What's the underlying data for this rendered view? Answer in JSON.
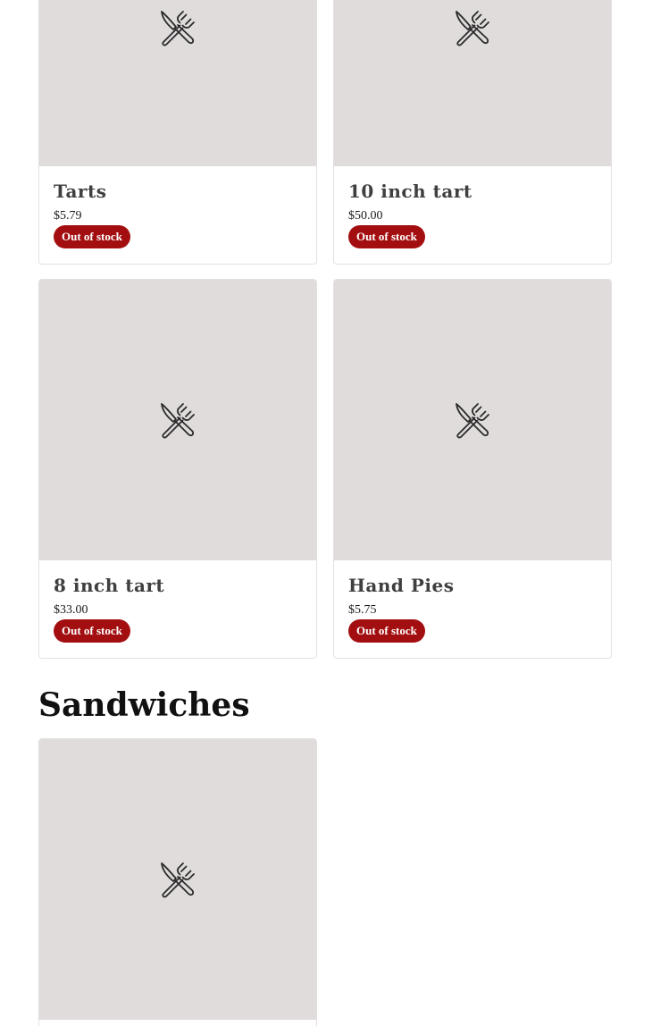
{
  "theme": {
    "badge_color": "#a30f10",
    "placeholder_color": "#dfdcdb"
  },
  "products": [
    {
      "name": "Tarts",
      "price": "$5.79",
      "stock_status": "Out of stock",
      "image_icon": "fork-knife-icon"
    },
    {
      "name": "10 inch tart",
      "price": "$50.00",
      "stock_status": "Out of stock",
      "image_icon": "fork-knife-icon"
    },
    {
      "name": "8 inch tart",
      "price": "$33.00",
      "stock_status": "Out of stock",
      "image_icon": "fork-knife-icon"
    },
    {
      "name": "Hand Pies",
      "price": "$5.75",
      "stock_status": "Out of stock",
      "image_icon": "fork-knife-icon"
    }
  ],
  "sections": [
    {
      "title": "Sandwiches"
    }
  ]
}
